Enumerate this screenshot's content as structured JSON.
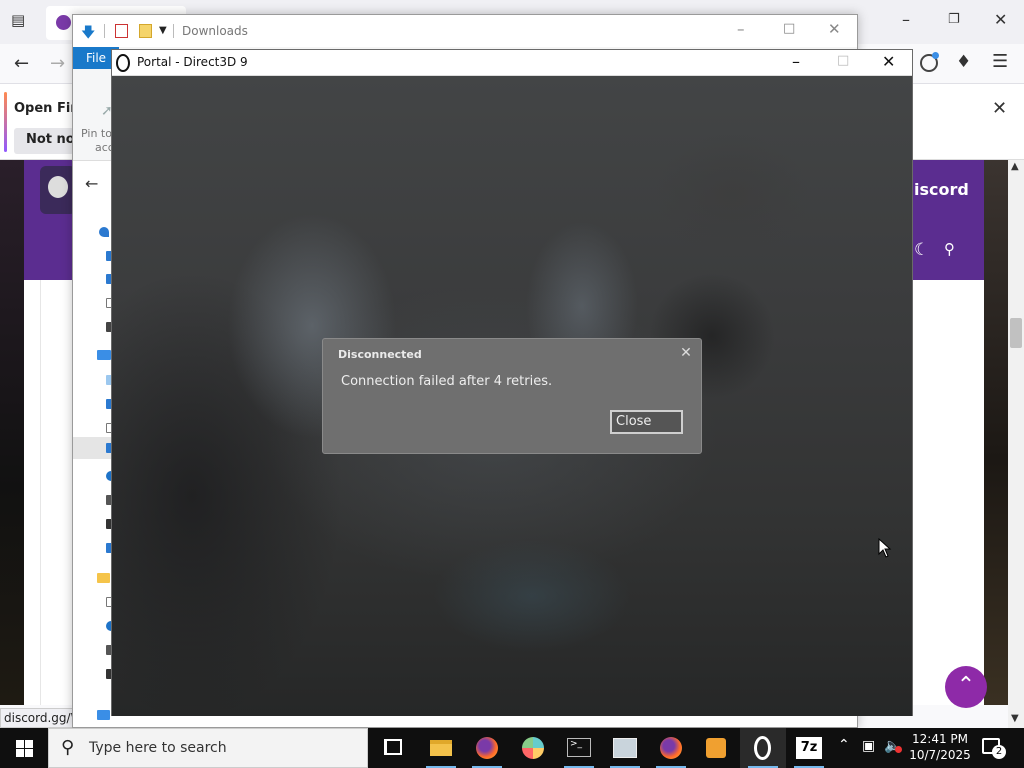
{
  "firefox": {
    "notification_title": "Open Firef",
    "notification_button": "Not now",
    "site_name": "iscord",
    "status_url": "discord.gg/W"
  },
  "explorer": {
    "title": "Downloads",
    "file_tab": "File",
    "pin_label_1": "Pin to",
    "pin_label_2": "acc"
  },
  "portal": {
    "window_title": "Portal - Direct3D 9",
    "dialog": {
      "title": "Disconnected",
      "message": "Connection failed after 4 retries.",
      "close_button": "Close"
    }
  },
  "taskbar": {
    "search_placeholder": "Type here to search",
    "time": "12:41 PM",
    "date": "10/7/2025",
    "notification_count": "2",
    "apps": [
      "task-view",
      "file-explorer",
      "firefox",
      "paint",
      "terminal",
      "photos",
      "firefox-2",
      "media-player",
      "portal",
      "7zip"
    ]
  },
  "colors": {
    "site_purple": "#5b2d90",
    "scroll_top_purple": "#8e2aa8",
    "explorer_file_tab": "#1979ca",
    "dialog_bg": "#6f6f6f",
    "taskbar_bg": "#0f0f0f"
  }
}
